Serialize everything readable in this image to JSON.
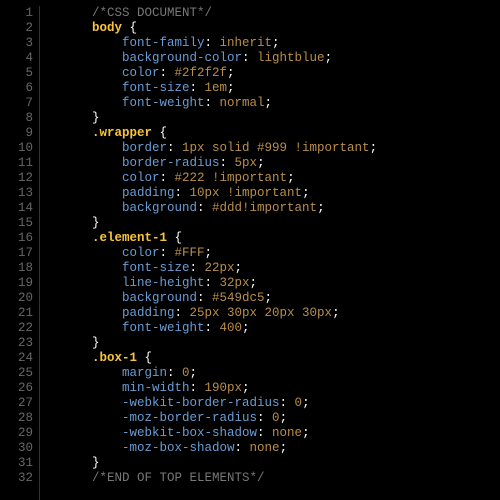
{
  "lineCount": 32,
  "code": {
    "lines": [
      {
        "type": "comment",
        "indent": 1,
        "text": "/*CSS DOCUMENT*/"
      },
      {
        "type": "selector-open",
        "indent": 1,
        "selector": "body"
      },
      {
        "type": "decl",
        "indent": 2,
        "prop": "font-family",
        "value": "inherit"
      },
      {
        "type": "decl",
        "indent": 2,
        "prop": "background-color",
        "value": "lightblue"
      },
      {
        "type": "decl",
        "indent": 2,
        "prop": "color",
        "value": "#2f2f2f"
      },
      {
        "type": "decl",
        "indent": 2,
        "prop": "font-size",
        "value": "1em"
      },
      {
        "type": "decl",
        "indent": 2,
        "prop": "font-weight",
        "value": "normal"
      },
      {
        "type": "close",
        "indent": 1
      },
      {
        "type": "selector-open",
        "indent": 1,
        "selector": ".wrapper"
      },
      {
        "type": "decl",
        "indent": 2,
        "prop": "border",
        "value": "1px solid #999 !important"
      },
      {
        "type": "decl",
        "indent": 2,
        "prop": "border-radius",
        "value": "5px"
      },
      {
        "type": "decl",
        "indent": 2,
        "prop": "color",
        "value": "#222 !important"
      },
      {
        "type": "decl",
        "indent": 2,
        "prop": "padding",
        "value": "10px !important"
      },
      {
        "type": "decl",
        "indent": 2,
        "prop": "background",
        "value": "#ddd!important"
      },
      {
        "type": "close",
        "indent": 1
      },
      {
        "type": "selector-open",
        "indent": 1,
        "selector": ".element-1"
      },
      {
        "type": "decl",
        "indent": 2,
        "prop": "color",
        "value": "#FFF"
      },
      {
        "type": "decl",
        "indent": 2,
        "prop": "font-size",
        "value": "22px"
      },
      {
        "type": "decl",
        "indent": 2,
        "prop": "line-height",
        "value": "32px"
      },
      {
        "type": "decl",
        "indent": 2,
        "prop": "background",
        "value": "#549dc5"
      },
      {
        "type": "decl",
        "indent": 2,
        "prop": "padding",
        "value": "25px 30px 20px 30px"
      },
      {
        "type": "decl",
        "indent": 2,
        "prop": "font-weight",
        "value": "400"
      },
      {
        "type": "close",
        "indent": 1
      },
      {
        "type": "selector-open",
        "indent": 1,
        "selector": ".box-1"
      },
      {
        "type": "decl",
        "indent": 2,
        "prop": "margin",
        "value": "0"
      },
      {
        "type": "decl",
        "indent": 2,
        "prop": "min-width",
        "value": "190px"
      },
      {
        "type": "decl",
        "indent": 2,
        "prop": "-webkit-border-radius",
        "value": "0"
      },
      {
        "type": "decl",
        "indent": 2,
        "prop": "-moz-border-radius",
        "value": "0"
      },
      {
        "type": "decl",
        "indent": 2,
        "prop": "-webkit-box-shadow",
        "value": "none"
      },
      {
        "type": "decl",
        "indent": 2,
        "prop": "-moz-box-shadow",
        "value": "none"
      },
      {
        "type": "close",
        "indent": 1
      },
      {
        "type": "comment",
        "indent": 1,
        "text": "/*END OF TOP ELEMENTS*/"
      }
    ]
  }
}
